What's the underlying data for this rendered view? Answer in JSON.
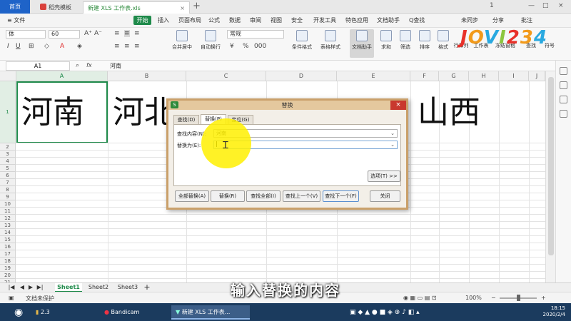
{
  "tabbar": {
    "home": "首页",
    "docer": "稻壳模板",
    "file": "新建 XLS 工作表.xls",
    "file_close": "×",
    "new_tab": "+",
    "window_buttons": [
      "1",
      "—",
      "□",
      "×"
    ]
  },
  "menubar": {
    "file_menu": "≡ 文件",
    "start": "开始",
    "items": [
      "插入",
      "页面布局",
      "公式",
      "数据",
      "审阅",
      "视图",
      "安全",
      "开发工具",
      "特色应用",
      "文档助手",
      "Q查找"
    ],
    "right_items": [
      "未同步",
      "分享",
      "批注"
    ]
  },
  "ribbon": {
    "font_name": "体",
    "font_size": "60",
    "number_format": "常规",
    "buttons": [
      "合并居中",
      "自动换行",
      "条件格式",
      "表格样式",
      "文档助手",
      "求和",
      "筛选",
      "排序",
      "格式",
      "行和列",
      "工作表",
      "冻结窗格",
      "查找",
      "符号"
    ]
  },
  "logo": {
    "text": "JOVI234",
    "colors": [
      "#e8312a",
      "#f29a1b",
      "#29a9e0",
      "#8cc63f",
      "#e8312a",
      "#f29a1b",
      "#29a9e0"
    ]
  },
  "formula": {
    "name_box": "A1",
    "fx": "fx",
    "content": "河南"
  },
  "grid": {
    "columns": [
      "A",
      "B",
      "C",
      "D",
      "E",
      "F",
      "G",
      "H",
      "I",
      "J"
    ],
    "rows": [
      "1",
      "2",
      "3",
      "4",
      "5",
      "6",
      "7",
      "8",
      "9",
      "10",
      "11",
      "12",
      "13",
      "14",
      "15",
      "16",
      "17",
      "18",
      "19",
      "20",
      "21"
    ],
    "cells": {
      "A1": "河南",
      "B1": "河北",
      "F1": "山西"
    }
  },
  "sheets": [
    "Sheet1",
    "Sheet2",
    "Sheet3"
  ],
  "status": {
    "protect": "文档未保护",
    "zoom": "100%",
    "zoom_level": 100
  },
  "taskbar": {
    "items": [
      "2.3",
      "Bandicam",
      "新建 XLS 工作表..."
    ],
    "time": "18:15",
    "date": "2020/2/4"
  },
  "dialog": {
    "title": "替换",
    "close": "×",
    "tabs": [
      "查找(D)",
      "替换(P)",
      "定位(G)"
    ],
    "active_tab": 1,
    "find_label": "查找内容(N):",
    "find_value": "河南",
    "replace_label": "替换为(E):",
    "replace_value": "",
    "options": "选项(T) >>",
    "buttons": [
      "全部替换(A)",
      "替换(R)",
      "查找全部(I)",
      "查找上一个(V)",
      "查找下一个(F)",
      "关闭"
    ]
  },
  "caption": "输入替换的内容",
  "colors": {
    "accent": "#1e8a4a",
    "tab_blue": "#1e63c8",
    "dialog_border": "#caa06a",
    "highlight": "#fff000",
    "taskbar": "#1b3b5e"
  }
}
